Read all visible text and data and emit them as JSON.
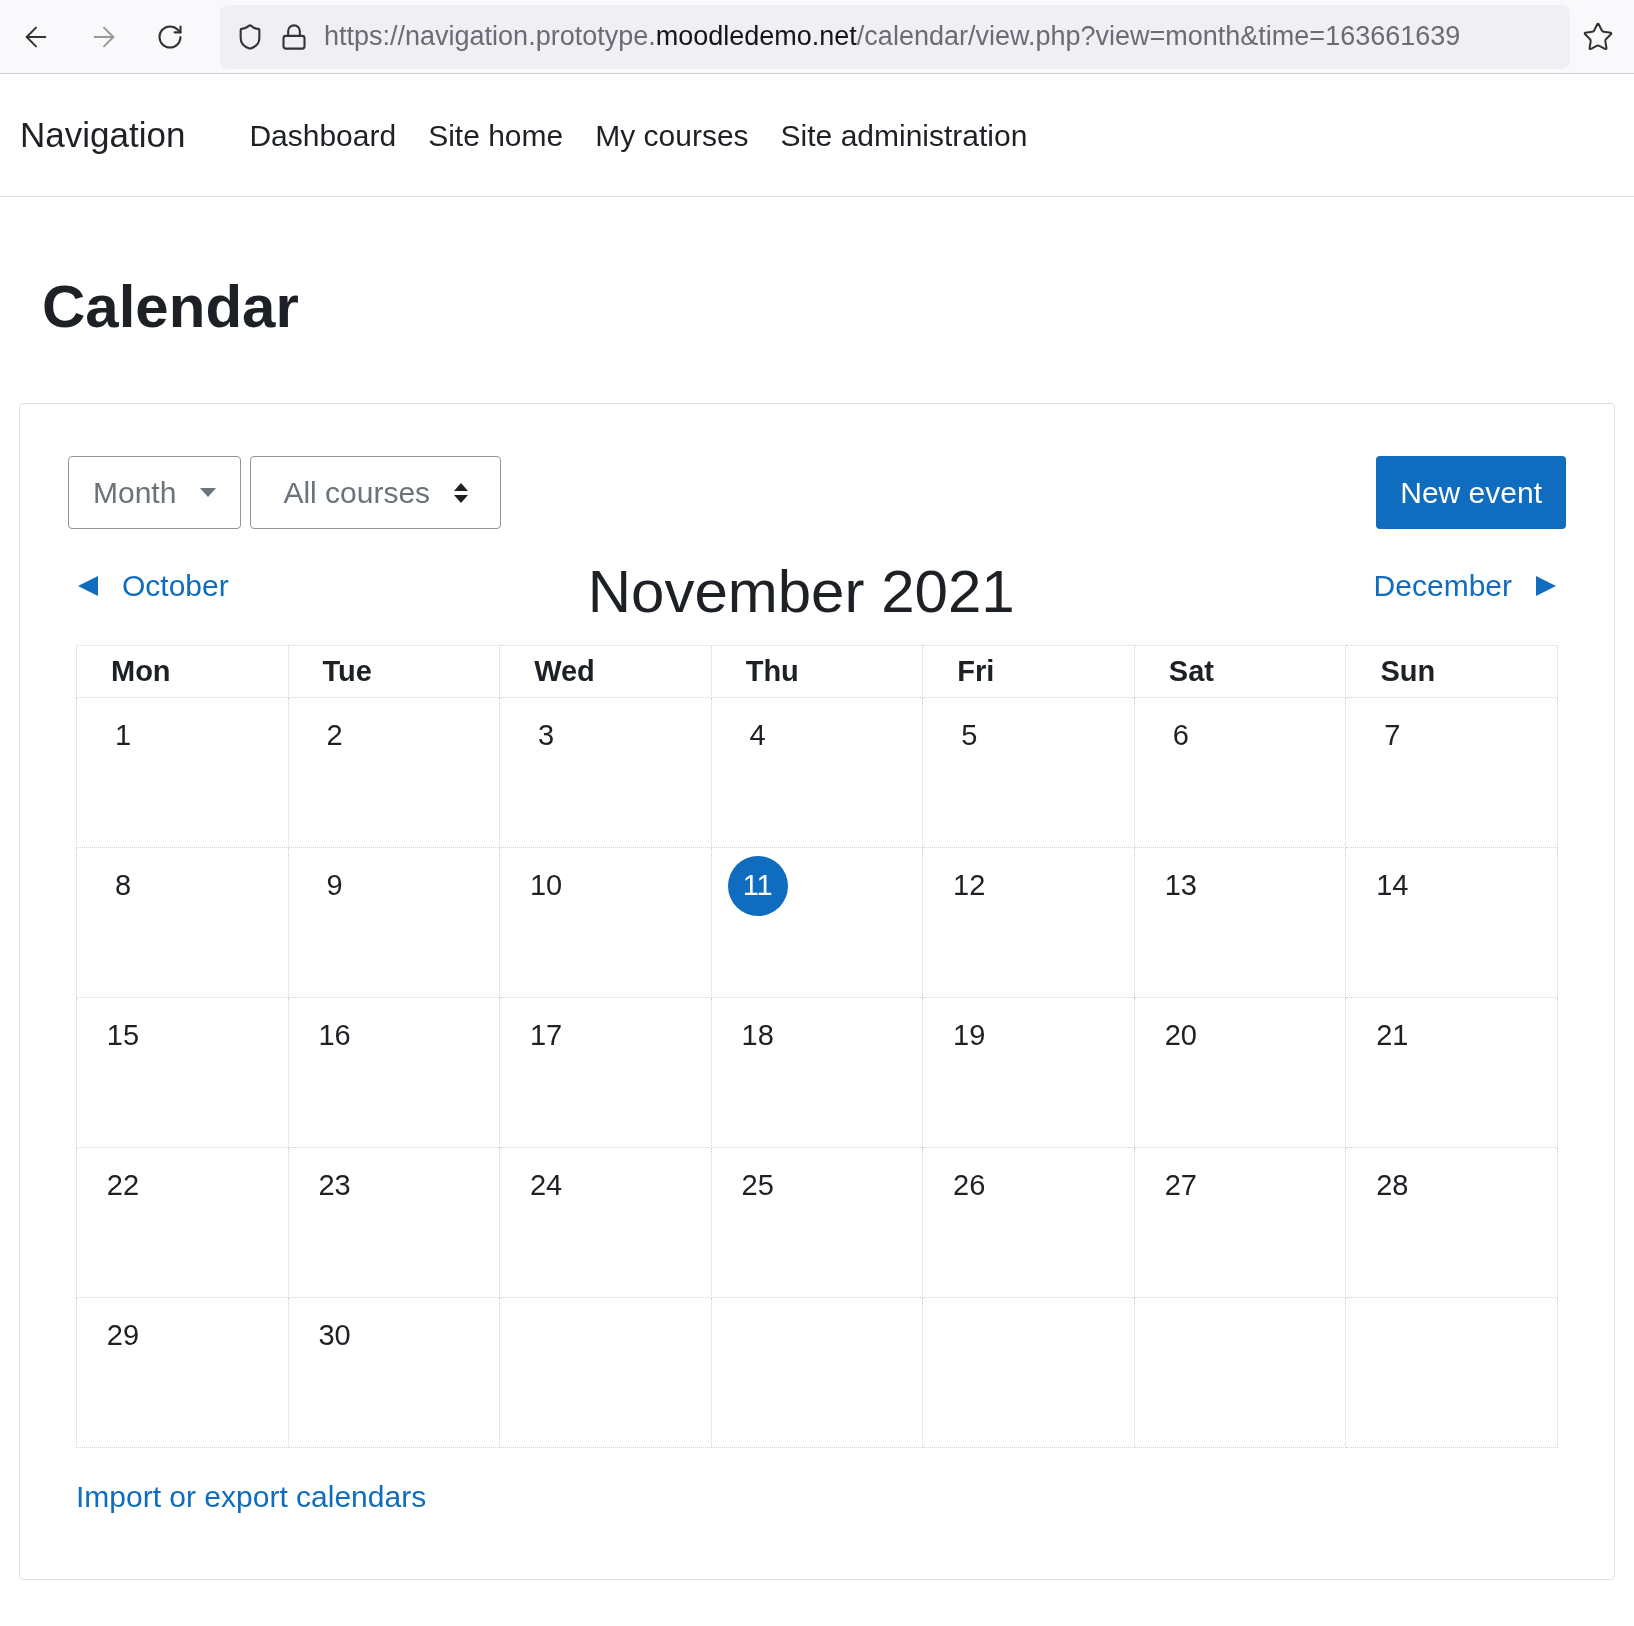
{
  "browser": {
    "url_prefix": "https://navigation.prototype.",
    "url_host": "moodledemo.net",
    "url_path": "/calendar/view.php?view=month&time=163661639"
  },
  "navbar": {
    "brand": "Navigation",
    "links": [
      "Dashboard",
      "Site home",
      "My courses",
      "Site administration"
    ]
  },
  "page_title": "Calendar",
  "controls": {
    "view_select": "Month",
    "course_select": "All courses",
    "new_event": "New event"
  },
  "month_nav": {
    "previous": "October",
    "current": "November 2021",
    "next": "December"
  },
  "weekdays": [
    "Mon",
    "Tue",
    "Wed",
    "Thu",
    "Fri",
    "Sat",
    "Sun"
  ],
  "weeks": [
    [
      {
        "label": "1",
        "today": false
      },
      {
        "label": "2",
        "today": false
      },
      {
        "label": "3",
        "today": false
      },
      {
        "label": "4",
        "today": false
      },
      {
        "label": "5",
        "today": false
      },
      {
        "label": "6",
        "today": false
      },
      {
        "label": "7",
        "today": false
      }
    ],
    [
      {
        "label": "8",
        "today": false
      },
      {
        "label": "9",
        "today": false
      },
      {
        "label": "10",
        "today": false
      },
      {
        "label": "11",
        "today": true
      },
      {
        "label": "12",
        "today": false
      },
      {
        "label": "13",
        "today": false
      },
      {
        "label": "14",
        "today": false
      }
    ],
    [
      {
        "label": "15",
        "today": false
      },
      {
        "label": "16",
        "today": false
      },
      {
        "label": "17",
        "today": false
      },
      {
        "label": "18",
        "today": false
      },
      {
        "label": "19",
        "today": false
      },
      {
        "label": "20",
        "today": false
      },
      {
        "label": "21",
        "today": false
      }
    ],
    [
      {
        "label": "22",
        "today": false
      },
      {
        "label": "23",
        "today": false
      },
      {
        "label": "24",
        "today": false
      },
      {
        "label": "25",
        "today": false
      },
      {
        "label": "26",
        "today": false
      },
      {
        "label": "27",
        "today": false
      },
      {
        "label": "28",
        "today": false
      }
    ],
    [
      {
        "label": "29",
        "today": false
      },
      {
        "label": "30",
        "today": false
      }
    ]
  ],
  "footer_link": "Import or export calendars"
}
